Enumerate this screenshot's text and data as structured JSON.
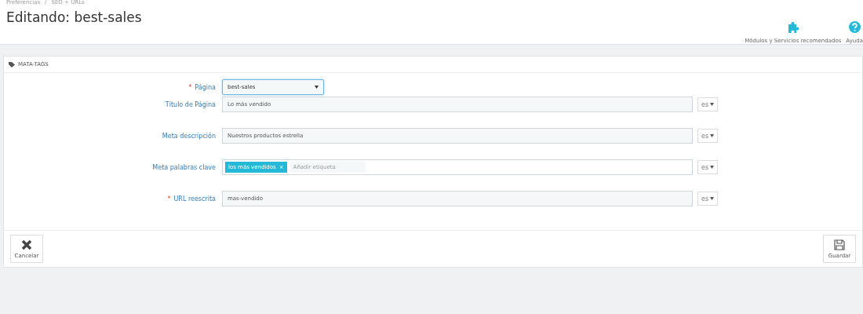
{
  "breadcrumb": [
    "Preferencias",
    "SEO + URLs"
  ],
  "breadcrumb_separator": "/",
  "title": "Editando: best-sales",
  "toolbar": [
    {
      "kind": "modules",
      "label": "Módulos y Servicios recomendados"
    },
    {
      "kind": "help",
      "label": "Ayuda"
    }
  ],
  "panel": {
    "heading": "MATA-TAGS",
    "required_mark": "*",
    "fields": [
      {
        "kind": "select",
        "label": "Página",
        "required": true,
        "value": "best-sales"
      },
      {
        "kind": "text",
        "label": "Título de Página",
        "required": false,
        "value": "Lo más vendido",
        "lang": "es"
      },
      {
        "kind": "text",
        "label": "Meta descripción",
        "required": false,
        "value": "Nuestros productos estrella",
        "lang": "es"
      },
      {
        "kind": "tags",
        "label": "Meta palabras clave",
        "required": false,
        "tags": [
          {
            "label": "los más vendidos",
            "remove": "×"
          }
        ],
        "placeholder": "Añadir etiqueta",
        "lang": "es"
      },
      {
        "kind": "text",
        "label": "URL reescrita",
        "required": true,
        "value": "mas-vendido",
        "lang": "es"
      }
    ],
    "buttons": [
      {
        "kind": "cancel",
        "label": "Cancelar"
      },
      {
        "kind": "save",
        "label": "Guardar"
      }
    ]
  }
}
